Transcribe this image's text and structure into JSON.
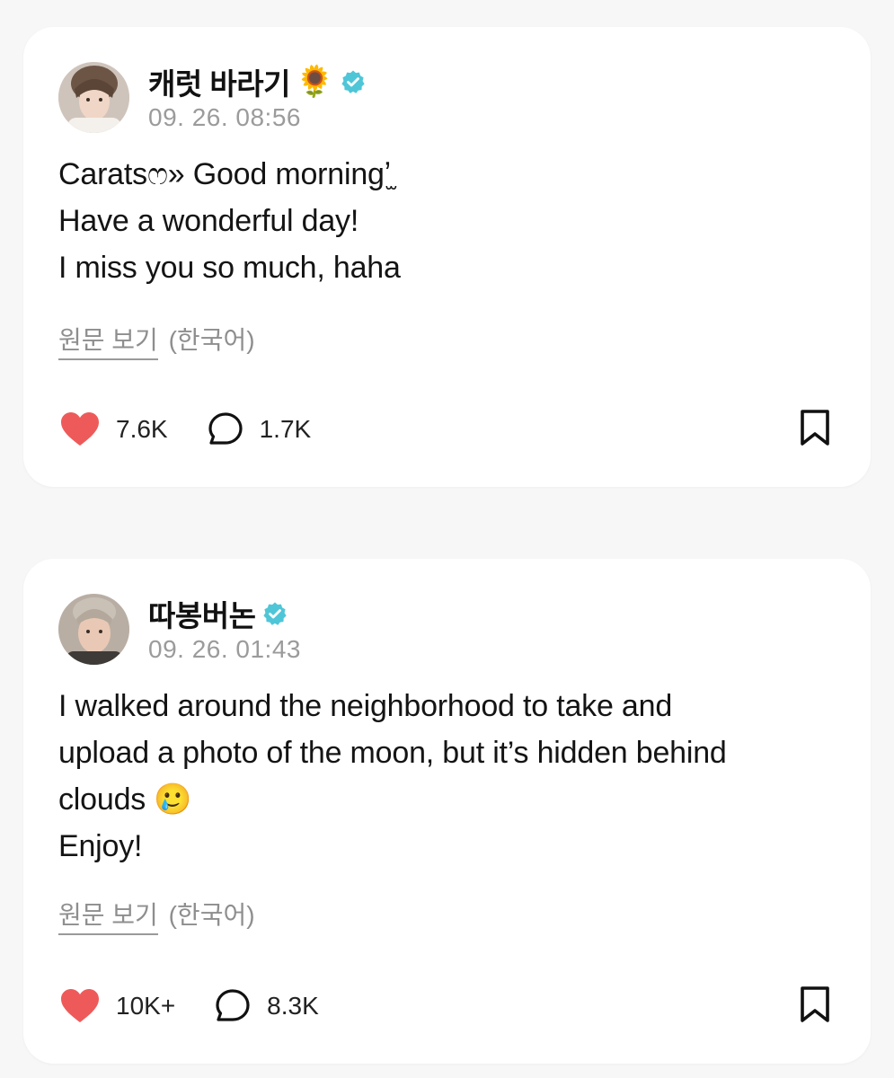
{
  "posts": [
    {
      "author": "캐럿 바라기",
      "author_emoji": "🌻",
      "verified": true,
      "timestamp": "09. 26. 08:56",
      "lines": [
        "Caratsෆ» Good morningʼ̫",
        "Have a wonderful day!",
        "I miss you so much, haha"
      ],
      "translate_link": "원문 보기",
      "translate_lang": "(한국어)",
      "likes": "7.6K",
      "comments": "1.7K"
    },
    {
      "author": "따봉버논",
      "author_emoji": "",
      "verified": true,
      "timestamp": "09. 26. 01:43",
      "lines": [
        "I walked around the neighborhood to take and",
        "upload a photo of the moon, but it’s hidden behind",
        "clouds 🥲",
        "Enjoy!"
      ],
      "translate_link": "원문 보기",
      "translate_lang": "(한국어)",
      "likes": "10K+",
      "comments": "8.3K"
    }
  ],
  "colors": {
    "background": "#f7f7f7",
    "card": "#ffffff",
    "heart": "#ee5a5a",
    "verified": "#4fc6d8",
    "muted": "#9b9b9b"
  },
  "icons": [
    "heart-icon",
    "comment-bubble-icon",
    "bookmark-icon",
    "verified-badge-icon"
  ]
}
